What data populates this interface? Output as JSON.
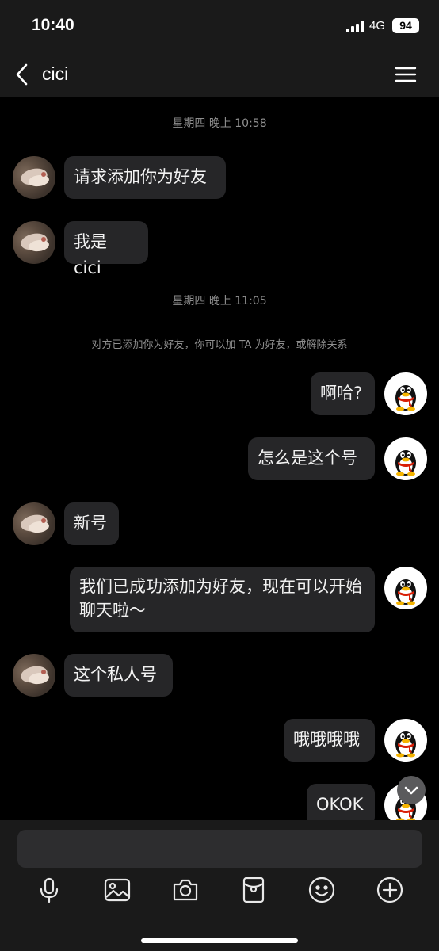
{
  "status_bar": {
    "time": "10:40",
    "network": "4G",
    "battery": "94"
  },
  "header": {
    "title": "cici",
    "back_icon": "chevron-left-icon",
    "menu_icon": "hamburger-menu-icon"
  },
  "messages": {
    "timestamp_1": "星期四 晚上 10:58",
    "m1": "请求添加你为好友",
    "m2": "我是 cici",
    "timestamp_2": "星期四 晚上 11:05",
    "system_note": "对方已添加你为好友，你可以加 TA 为好友，或解除关系",
    "m3": "啊哈?",
    "m4": "怎么是这个号",
    "m5": "新号",
    "m6": "我们已成功添加为好友，现在可以开始聊天啦～",
    "m7": "这个私人号",
    "m8": "哦哦哦哦",
    "m9": "OKOK"
  },
  "input": {
    "placeholder": ""
  },
  "toolbar": {
    "icons": [
      "microphone-icon",
      "image-icon",
      "camera-icon",
      "red-packet-icon",
      "emoji-icon",
      "plus-icon"
    ]
  },
  "colors": {
    "background": "#000000",
    "bar": "#1a1a1a",
    "bubble": "#262628",
    "muted_text": "#8f8f8f",
    "avatar_scarf": "#d81e06"
  }
}
